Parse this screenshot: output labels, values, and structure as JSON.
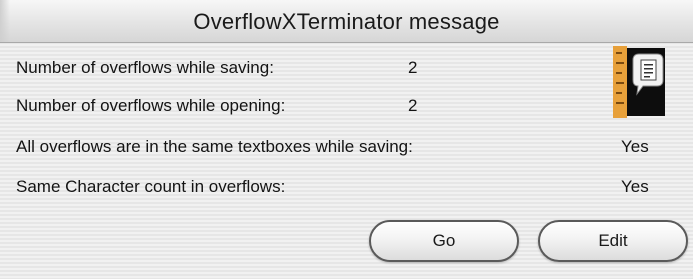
{
  "dialog": {
    "title": "OverflowXTerminator message"
  },
  "rows": [
    {
      "label": "Number of overflows while saving:",
      "value": "2"
    },
    {
      "label": "Number of overflows while opening:",
      "value": "2"
    },
    {
      "label": "All overflows are in the same textboxes while saving:",
      "value": "Yes"
    },
    {
      "label": "Same Character count in overflows:",
      "value": "Yes"
    }
  ],
  "icon": {
    "name": "document-icon"
  },
  "buttons": {
    "go_label": "Go",
    "edit_label": "Edit"
  }
}
